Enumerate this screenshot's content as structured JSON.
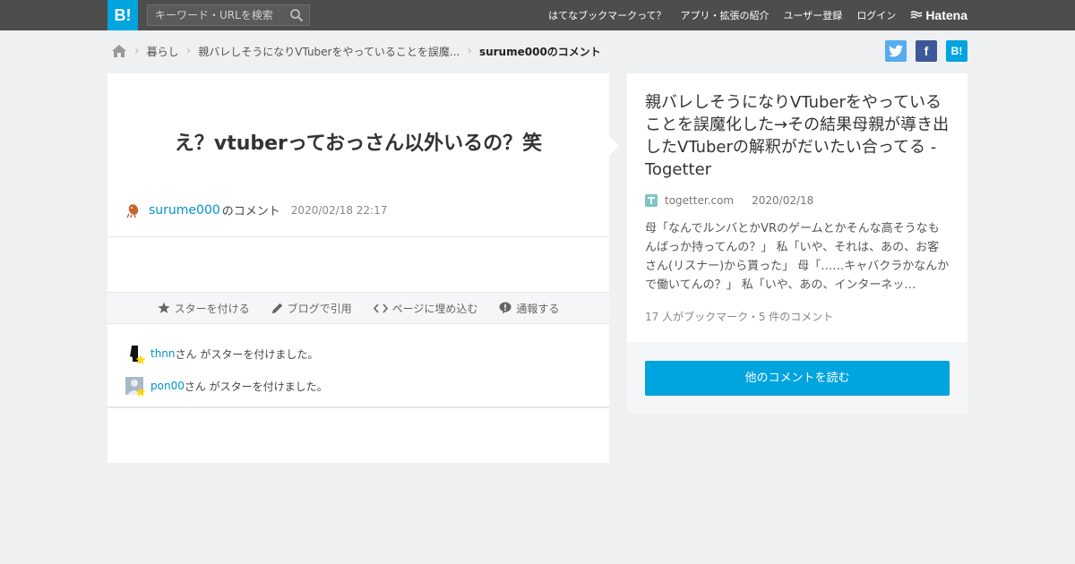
{
  "header": {
    "logo": "B!",
    "search_placeholder": "キーワード・URLを検索",
    "nav": [
      "はてなブックマークって？",
      "アプリ・拡張の紹介",
      "ユーザー登録",
      "ログイン"
    ],
    "brand": "Hatena"
  },
  "breadcrumb": {
    "items": [
      "暮らし",
      "親バレしそうになりVTuberをやっていることを誤魔..."
    ],
    "current": "surume000のコメント"
  },
  "share": {
    "twitter": "",
    "facebook": "f",
    "hatena": "B!"
  },
  "comment": {
    "text": "え？vtuberっておっさん以外いるの？笑",
    "user": "surume000",
    "suffix": "のコメント",
    "date": "2020/02/18 22:17"
  },
  "actions": {
    "star": "スターを付ける",
    "blog": "ブログで引用",
    "embed": "ページに埋め込む",
    "report": "通報する"
  },
  "stars": [
    {
      "user": "thnn",
      "text": "さん がスターを付けました。"
    },
    {
      "user": "pon00",
      "text": "さん がスターを付けました。"
    }
  ],
  "entry": {
    "title": "親バレしそうになりVTuberをやっていることを誤魔化した→その結果母親が導き出したVTuberの解釈がだいたい合ってる - Togetter",
    "domain": "togetter.com",
    "date": "2020/02/18",
    "description": "母「なんでルンバとかVRのゲームとかそんな高そうなもんばっか持ってんの？」 私「いや、それは、あの、お客さん(リスナー)から貰った」 母「……キャバクラかなんかで働いてんの？」 私「いや、あの、インターネッ…",
    "stats": "17 人がブックマーク・5 件のコメント",
    "more_button": "他のコメントを読む"
  },
  "colors": {
    "accent": "#00a4de",
    "link": "#0093c9",
    "topbar": "#4d4d4d"
  }
}
